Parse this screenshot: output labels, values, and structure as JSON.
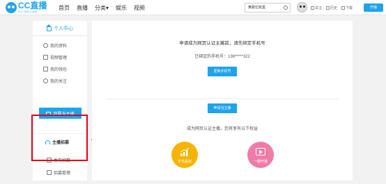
{
  "header": {
    "logo_text": "CC直播",
    "logo_sub": "CC.163.COM",
    "nav": [
      "首页",
      "直播",
      "分类▾",
      "娱乐",
      "视频"
    ],
    "search_value": "黄鹂亿抢盒",
    "actions": [
      "关注",
      "历史",
      "下载"
    ],
    "live_button": "开播"
  },
  "sidebar": {
    "title": "个人中心",
    "items": [
      "我的资料",
      "视频管理",
      "我的钱包",
      "我的关注"
    ],
    "anchor_button": "我要当主播",
    "section2_title": "主播招募",
    "section2_items": [
      "发布招募",
      "招募管理"
    ]
  },
  "main": {
    "verify_prompt": "申请成为网页认证主播前，请先绑定手机号",
    "phone_label": "已绑定的手机号：",
    "phone_value": "136*****322",
    "change_phone_button": "更换手机号",
    "apply_button": "申请当主播",
    "benefits_title": "成为网页认证主播，您将享有以下权益",
    "benefits": [
      "羊毛提成",
      "一键开播"
    ]
  },
  "colors": {
    "accent": "#1fa3ea",
    "annotation": "#e0001a",
    "gold": "#f5b400",
    "pink": "#f07aa8"
  }
}
